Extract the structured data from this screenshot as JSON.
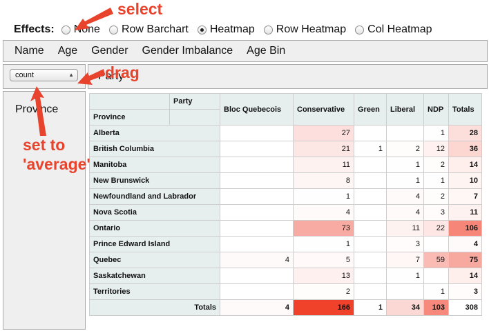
{
  "effects": {
    "label": "Effects:",
    "options": [
      {
        "label": "None",
        "selected": false
      },
      {
        "label": "Row Barchart",
        "selected": false
      },
      {
        "label": "Heatmap",
        "selected": true
      },
      {
        "label": "Row Heatmap",
        "selected": false
      },
      {
        "label": "Col Heatmap",
        "selected": false
      }
    ]
  },
  "attributes": [
    "Name",
    "Age",
    "Gender",
    "Gender Imbalance",
    "Age Bin"
  ],
  "aggregator": {
    "selected": "count"
  },
  "cols_attr": "Party",
  "rows_attr": "Province",
  "table": {
    "col_attr": "Party",
    "row_attr": "Province",
    "columns": [
      "Bloc Quebecois",
      "Conservative",
      "Green",
      "Liberal",
      "NDP"
    ],
    "totals_label": "Totals",
    "rows": [
      {
        "name": "Alberta",
        "values": [
          "",
          "27",
          "",
          "",
          "1"
        ],
        "total": "28"
      },
      {
        "name": "British Columbia",
        "values": [
          "",
          "21",
          "1",
          "2",
          "12"
        ],
        "total": "36"
      },
      {
        "name": "Manitoba",
        "values": [
          "",
          "11",
          "",
          "1",
          "2"
        ],
        "total": "14"
      },
      {
        "name": "New Brunswick",
        "values": [
          "",
          "8",
          "",
          "1",
          "1"
        ],
        "total": "10"
      },
      {
        "name": "Newfoundland and Labrador",
        "values": [
          "",
          "1",
          "",
          "4",
          "2"
        ],
        "total": "7"
      },
      {
        "name": "Nova Scotia",
        "values": [
          "",
          "4",
          "",
          "4",
          "3"
        ],
        "total": "11"
      },
      {
        "name": "Ontario",
        "values": [
          "",
          "73",
          "",
          "11",
          "22"
        ],
        "total": "106"
      },
      {
        "name": "Prince Edward Island",
        "values": [
          "",
          "1",
          "",
          "3",
          ""
        ],
        "total": "4"
      },
      {
        "name": "Quebec",
        "values": [
          "4",
          "5",
          "",
          "7",
          "59"
        ],
        "total": "75"
      },
      {
        "name": "Saskatchewan",
        "values": [
          "",
          "13",
          "",
          "1",
          ""
        ],
        "total": "14"
      },
      {
        "name": "Territories",
        "values": [
          "",
          "2",
          "",
          "",
          "1"
        ],
        "total": "3"
      }
    ],
    "col_totals": [
      "4",
      "166",
      "1",
      "34",
      "103"
    ],
    "grand_total": "308"
  },
  "annotations": {
    "select": "select",
    "drag": "drag",
    "set_to_line1": "set to",
    "set_to_line2": "'average'"
  },
  "colors": {
    "annotation": "#e8432d",
    "heat_max": "#f0412b",
    "header_bg": "#e6eeee",
    "box_bg": "#efefef"
  }
}
